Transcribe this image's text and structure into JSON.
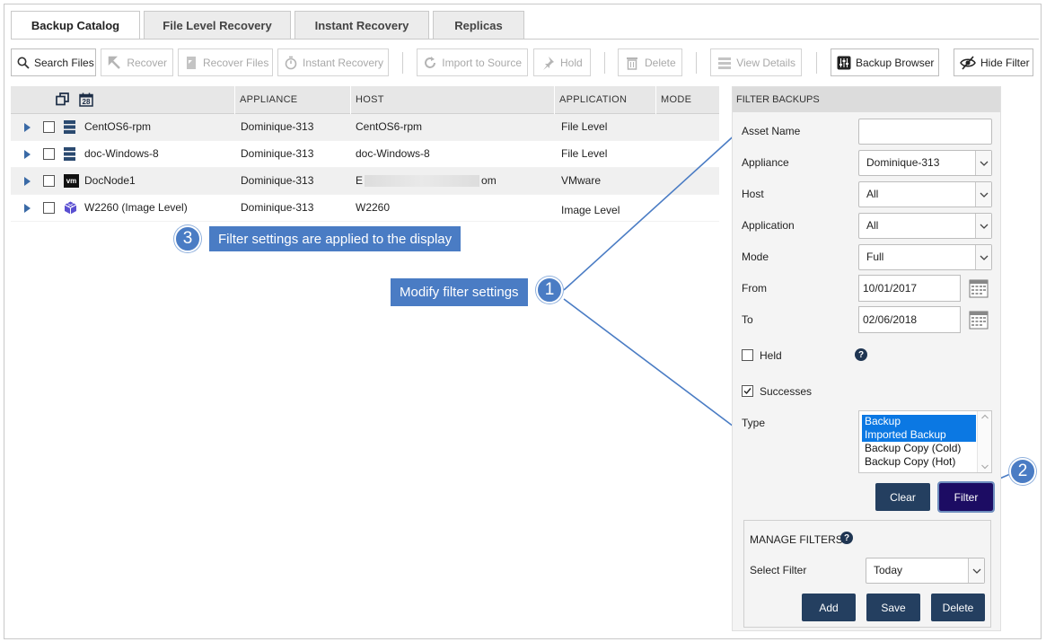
{
  "tabs": [
    {
      "label": "Backup Catalog",
      "active": true
    },
    {
      "label": "File Level Recovery",
      "active": false
    },
    {
      "label": "Instant Recovery",
      "active": false
    },
    {
      "label": "Replicas",
      "active": false
    }
  ],
  "toolbar": {
    "search_files": "Search Files",
    "recover": "Recover",
    "recover_files": "Recover Files",
    "instant_recovery": "Instant Recovery",
    "import_to_source": "Import to Source",
    "hold": "Hold",
    "delete": "Delete",
    "view_details": "View Details",
    "backup_browser": "Backup Browser",
    "hide_filter": "Hide Filter"
  },
  "grid": {
    "calendar_day": "28",
    "columns": {
      "appliance": "APPLIANCE",
      "host": "HOST",
      "application": "APPLICATION",
      "mode": "MODE"
    },
    "rows": [
      {
        "name": "CentOS6-rpm",
        "appliance": "Dominique-313",
        "host": "CentOS6-rpm",
        "application": "File Level",
        "icon": "server-icon"
      },
      {
        "name": "doc-Windows-8",
        "appliance": "Dominique-313",
        "host": "doc-Windows-8",
        "application": "File Level",
        "icon": "server-icon"
      },
      {
        "name": "DocNode1",
        "appliance": "Dominique-313",
        "host_prefix": "E",
        "host_suffix": "om",
        "application": "VMware",
        "icon": "vm-icon",
        "icon_text": "vm"
      },
      {
        "name": "W2260 (Image Level)",
        "appliance": "Dominique-313",
        "host": "W2260",
        "application": "Image Level",
        "icon": "cube-icon"
      }
    ]
  },
  "callouts": {
    "one": {
      "number": "1",
      "text": "Modify filter settings"
    },
    "two": {
      "number": "2"
    },
    "three": {
      "number": "3",
      "text": "Filter settings are applied to the display"
    }
  },
  "filter": {
    "header": "FILTER BACKUPS",
    "asset_name_label": "Asset Name",
    "asset_name_value": "",
    "appliance_label": "Appliance",
    "appliance_value": "Dominique-313",
    "host_label": "Host",
    "host_value": "All",
    "application_label": "Application",
    "application_value": "All",
    "mode_label": "Mode",
    "mode_value": "Full",
    "from_label": "From",
    "from_value": "10/01/2017",
    "to_label": "To",
    "to_value": "02/06/2018",
    "held_label": "Held",
    "held_checked": false,
    "successes_label": "Successes",
    "successes_checked": true,
    "type_label": "Type",
    "type_options": [
      {
        "label": "Backup",
        "selected": true
      },
      {
        "label": "Imported Backup",
        "selected": true
      },
      {
        "label": "Backup Copy (Cold)",
        "selected": false
      },
      {
        "label": "Backup Copy (Hot)",
        "selected": false
      }
    ],
    "clear_label": "Clear",
    "filter_label": "Filter",
    "help_glyph": "?",
    "manage": {
      "title": "MANAGE FILTERS",
      "select_filter_label": "Select Filter",
      "select_filter_value": "Today",
      "add_label": "Add",
      "save_label": "Save",
      "delete_label": "Delete"
    }
  },
  "colors": {
    "accent": "#4a7cc4",
    "navy_button": "#243f60",
    "filter_button": "#1c0c63",
    "selection": "#0b78e3"
  }
}
